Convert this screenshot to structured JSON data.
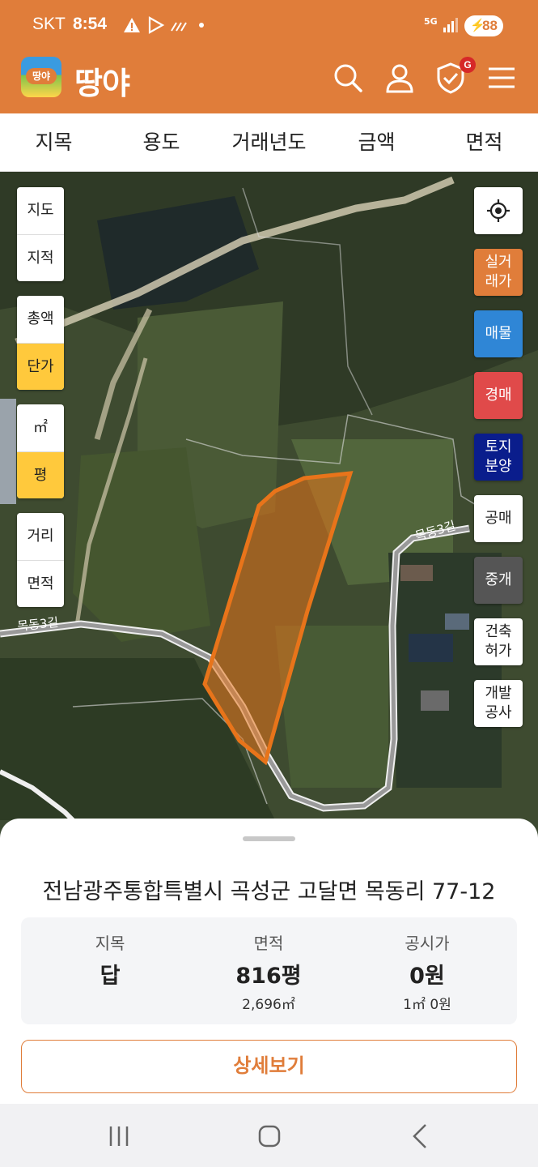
{
  "status_bar": {
    "carrier": "SKT",
    "time": "8:54",
    "network": "5G",
    "battery": "88"
  },
  "header": {
    "logo_badge": "땅야",
    "brand": "땅야",
    "alert_badge": "G"
  },
  "filters": [
    "지목",
    "용도",
    "거래년도",
    "금액",
    "면적"
  ],
  "map": {
    "road_label": "목동3길",
    "left_controls": {
      "map_type": [
        "지도",
        "지적"
      ],
      "price_mode": [
        "총액",
        "단가"
      ],
      "unit": [
        "㎡",
        "평"
      ],
      "measure": [
        "거리",
        "면적"
      ],
      "active": [
        "단가",
        "평"
      ]
    },
    "right_controls": [
      {
        "label": "실거\n래가",
        "color": "#e07d3a"
      },
      {
        "label": "매물",
        "color": "#2f86d6"
      },
      {
        "label": "경매",
        "color": "#e04a4a"
      },
      {
        "label": "토지\n분양",
        "color": "#0a1d8c"
      },
      {
        "label": "공매",
        "color": "#ffffff"
      },
      {
        "label": "중개",
        "color": "#555555"
      },
      {
        "label": "건축\n허가",
        "color": "#ffffff"
      },
      {
        "label": "개발\n공사",
        "color": "#ffffff"
      }
    ],
    "parcel_color": "#e8741a"
  },
  "sheet": {
    "address": "전남광주통합특별시 곡성군 고달면 목동리 77-12",
    "info": [
      {
        "label": "지목",
        "value": "답",
        "sub": ""
      },
      {
        "label": "면적",
        "value": "816평",
        "sub": "2,696㎡"
      },
      {
        "label": "공시가",
        "value": "0원",
        "sub": "1㎡ 0원"
      }
    ],
    "detail_button": "상세보기"
  }
}
